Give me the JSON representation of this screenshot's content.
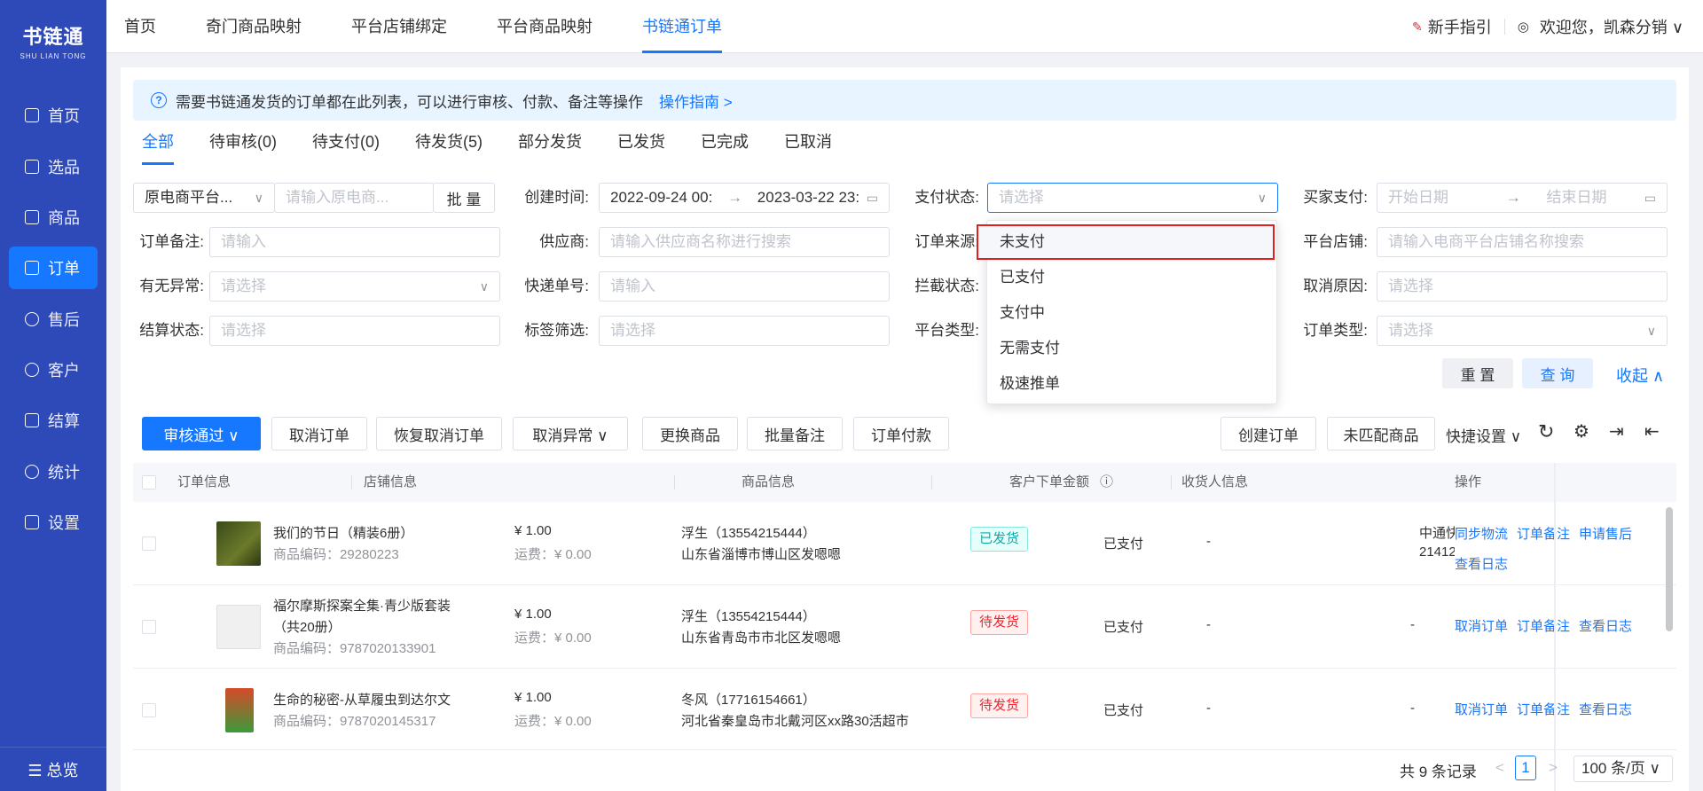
{
  "sidebar": {
    "logo_cn": "书链通",
    "logo_en": "SHU LIAN TONG",
    "items": [
      {
        "label": "首页",
        "icon": "monitor-icon"
      },
      {
        "label": "选品",
        "icon": "checklist-icon"
      },
      {
        "label": "商品",
        "icon": "box-icon"
      },
      {
        "label": "订单",
        "icon": "order-icon",
        "active": true
      },
      {
        "label": "售后",
        "icon": "headset-icon"
      },
      {
        "label": "客户",
        "icon": "user-icon"
      },
      {
        "label": "结算",
        "icon": "settle-icon"
      },
      {
        "label": "统计",
        "icon": "pie-icon"
      },
      {
        "label": "设置",
        "icon": "sliders-icon"
      }
    ],
    "bottom": "☰ 总览"
  },
  "header": {
    "nav": [
      "首页",
      "奇门商品映射",
      "平台店铺绑定",
      "平台商品映射",
      "书链通订单"
    ],
    "active_index": 4,
    "guide": "新手指引",
    "welcome": "欢迎您，凯森分销 ∨"
  },
  "notice": {
    "text": "需要书链通发货的订单都在此列表，可以进行审核、付款、备注等操作",
    "link": "操作指南 >"
  },
  "status_tabs": [
    "全部",
    "待审核(0)",
    "待支付(0)",
    "待发货(5)",
    "部分发货",
    "已发货",
    "已完成",
    "已取消"
  ],
  "filters": {
    "platform_select": "原电商平台...",
    "platform_input_placeholder": "请输入原电商...",
    "batch": "批 量",
    "created_label": "创建时间:",
    "created_start": "2022-09-24 00:",
    "created_sep": "→",
    "created_end": "2023-03-22 23:",
    "pay_status_label": "支付状态:",
    "pay_status_placeholder": "请选择",
    "buyer_pay_label": "买家支付:",
    "buyer_pay_start": "开始日期",
    "buyer_pay_sep": "→",
    "buyer_pay_end": "结束日期",
    "order_note_label": "订单备注:",
    "order_note_placeholder": "请输入",
    "supplier_label": "供应商:",
    "supplier_placeholder": "请输入供应商名称进行搜索",
    "order_source_label": "订单来源:",
    "shop_label": "平台店铺:",
    "shop_placeholder": "请输入电商平台店铺名称搜索",
    "abnormal_label": "有无异常:",
    "abnormal_placeholder": "请选择",
    "express_label": "快递单号:",
    "express_placeholder": "请输入",
    "intercept_label": "拦截状态:",
    "cancel_reason_label": "取消原因:",
    "cancel_reason_placeholder": "请选择",
    "settle_label": "结算状态:",
    "settle_placeholder": "请选择",
    "tag_label": "标签筛选:",
    "tag_placeholder": "请选择",
    "platform_type_label": "平台类型:",
    "order_type_label": "订单类型:",
    "order_type_placeholder": "请选择",
    "reset": "重 置",
    "search": "查 询",
    "collapse": "收起 ∧"
  },
  "pay_dropdown": [
    "未支付",
    "已支付",
    "支付中",
    "无需支付",
    "极速推单"
  ],
  "toolbar": {
    "approve": "审核通过 ∨",
    "cancel_order": "取消订单",
    "restore_cancel": "恢复取消订单",
    "cancel_abnormal": "取消异常 ∨",
    "replace_goods": "更换商品",
    "batch_note": "批量备注",
    "order_pay": "订单付款",
    "create_order": "创建订单",
    "unmatched": "未匹配商品",
    "quick_settings": "快捷设置 ∨"
  },
  "table": {
    "headers": [
      "订单信息",
      "店铺信息",
      "商品信息",
      "客户下单金额",
      "收货人信息",
      "操作"
    ],
    "rows": [
      {
        "title": "我们的节日（精装6册）",
        "code": "商品编码：29280223",
        "price": "¥ 1.00",
        "freight": "运费：¥ 0.00",
        "receiver": "浮生（13554215444）",
        "address": "山东省淄博市博山区发嗯嗯",
        "status": "已发货",
        "pay": "已支付",
        "dash": "-",
        "express": "中通快",
        "express_no": "21412",
        "ops": [
          "同步物流",
          "订单备注",
          "申请售后",
          "查看日志"
        ]
      },
      {
        "title": "福尔摩斯探案全集·青少版套装（共20册）",
        "code": "商品编码：9787020133901",
        "price": "¥ 1.00",
        "freight": "运费：¥ 0.00",
        "receiver": "浮生（13554215444）",
        "address": "山东省青岛市市北区发嗯嗯",
        "status": "待发货",
        "pay": "已支付",
        "dash": "-",
        "express": "-",
        "express_no": "",
        "ops": [
          "取消订单",
          "订单备注",
          "查看日志"
        ]
      },
      {
        "title": "生命的秘密-从草履虫到达尔文",
        "code": "商品编码：9787020145317",
        "price": "¥ 1.00",
        "freight": "运费：¥ 0.00",
        "receiver": "冬风（17716154661）",
        "address": "河北省秦皇岛市北戴河区xx路30活超市",
        "status": "待发货",
        "pay": "已支付",
        "dash": "-",
        "express": "-",
        "express_no": "",
        "ops": [
          "取消订单",
          "订单备注",
          "查看日志"
        ]
      }
    ]
  },
  "pagination": {
    "total": "共 9 条记录",
    "page": "1",
    "page_size": "100 条/页 ∨"
  },
  "colors": {
    "sidebar": "#2e49b8",
    "primary": "#1677ff",
    "highlight": "#e02020"
  }
}
